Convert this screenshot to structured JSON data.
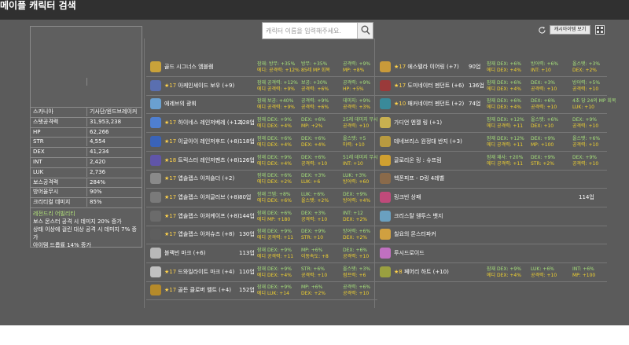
{
  "page": {
    "title": "메이플 캐릭터 검색"
  },
  "search": {
    "placeholder": "캐릭터 이름을 입력해주세요."
  },
  "toolbar": {
    "cash_item_label": "캐시아이템 보기"
  },
  "stats": [
    {
      "label": "스카니아",
      "value": "기사단/윈드브레이커"
    },
    {
      "label": "스탯공격력",
      "value": "31,953,238"
    },
    {
      "label": "HP",
      "value": "62,266"
    },
    {
      "label": "STR",
      "value": "4,554"
    },
    {
      "label": "DEX",
      "value": "41,234"
    },
    {
      "label": "INT",
      "value": "2,420"
    },
    {
      "label": "LUK",
      "value": "2,736"
    },
    {
      "label": "보스공격력",
      "value": "284%"
    },
    {
      "label": "방어율무시",
      "value": "90%"
    },
    {
      "label": "크리티컬 데미지",
      "value": "85%"
    }
  ],
  "ability": {
    "title": "레전드리 어빌리티",
    "lines": [
      "보스 몬스터 공격 시 데미지 20% 증가",
      "상태 이상에 걸린 대상 공격 시 데미지 7% 증가",
      "아이템 드롭률 14% 증가"
    ]
  },
  "items_left": [
    {
      "stars": "",
      "name": "골드 시그너스 엠블렘",
      "level": "",
      "color": "#c9a23a",
      "p": [
        [
          "잠재: 방무: +35%",
          "g"
        ],
        [
          "에디: 공격력: +12%",
          "y"
        ]
      ],
      "q": [
        [
          "방무: +35%",
          "g"
        ],
        [
          "85레 MP 회복",
          "y"
        ]
      ],
      "r": [
        [
          "공격력: +9%",
          "g"
        ],
        [
          "MP: +8%",
          "y"
        ]
      ]
    },
    {
      "stars": "★17",
      "name": "아케인셰이드 보우 (+9)",
      "level": "",
      "color": "#5a6fb0",
      "p": [
        [
          "잠재 공격력: +12%",
          "g"
        ],
        [
          "에디 공격력: +9%",
          "y"
        ]
      ],
      "q": [
        [
          "보공: +30%",
          "g"
        ],
        [
          "공격력: +6%",
          "y"
        ]
      ],
      "r": [
        [
          "공격력: +9%",
          "g"
        ],
        [
          "HP: +5%",
          "y"
        ]
      ]
    },
    {
      "stars": "",
      "name": "에레브의 광휘",
      "level": "",
      "color": "#6aa0d0",
      "p": [
        [
          "잠재 보공: +40%",
          "g"
        ],
        [
          "에디 공격력: +9%",
          "y"
        ]
      ],
      "q": [
        [
          "공격력: +9%",
          "g"
        ],
        [
          "공격력: +6%",
          "y"
        ]
      ],
      "r": [
        [
          "데미지: +9%",
          "g"
        ],
        [
          "공격력: +3%",
          "y"
        ]
      ]
    },
    {
      "stars": "★17",
      "name": "하이네스 레인저베레 (+12)",
      "level": "128업",
      "color": "#4f7fd0",
      "p": [
        [
          "잠재 DEX: +9%",
          "g"
        ],
        [
          "에디 DEX: +4%",
          "y"
        ]
      ],
      "q": [
        [
          "DEX: +6%",
          "g"
        ],
        [
          "MP: +2%",
          "y"
        ]
      ],
      "r": [
        [
          "25레 데미지 무시",
          "g"
        ],
        [
          "공격력: +10",
          "y"
        ]
      ]
    },
    {
      "stars": "★17",
      "name": "이글아이 레인저후드 (+8)",
      "level": "118업",
      "color": "#3a63b8",
      "p": [
        [
          "잠재 DEX: +6%",
          "g"
        ],
        [
          "에디 DEX: +4%",
          "y"
        ]
      ],
      "q": [
        [
          "DEX: +6%",
          "g"
        ],
        [
          "DEX: +4%",
          "y"
        ]
      ],
      "r": [
        [
          "올스탯: +5",
          "g"
        ],
        [
          "마력: +10",
          "y"
        ]
      ]
    },
    {
      "stars": "★18",
      "name": "트릭스터 레인저팬츠 (+8)",
      "level": "126업",
      "color": "#6055a8",
      "p": [
        [
          "잠재 DEX: +9%",
          "g"
        ],
        [
          "에디 DEX: +4%",
          "y"
        ]
      ],
      "q": [
        [
          "DEX: +6%",
          "g"
        ],
        [
          "공격력: +10",
          "y"
        ]
      ],
      "r": [
        [
          "51레 데미지 무시",
          "g"
        ],
        [
          "INT: +10",
          "y"
        ]
      ]
    },
    {
      "stars": "★17",
      "name": "앱솔랩스 아처숄더 (+2)",
      "level": "",
      "color": "#8a8a8a",
      "p": [
        [
          "잠재 DEX: +6%",
          "g"
        ],
        [
          "에디 DEX: +2%",
          "y"
        ]
      ],
      "q": [
        [
          "DEX: +3%",
          "g"
        ],
        [
          "LUK: +6",
          "y"
        ]
      ],
      "r": [
        [
          "LUK: +3%",
          "g"
        ],
        [
          "방어력: +60",
          "y"
        ]
      ]
    },
    {
      "stars": "★17",
      "name": "앱솔랩스 아처글러브 (+8)",
      "level": "80업",
      "color": "#7a7a7a",
      "p": [
        [
          "잠재 크뎀: +8%",
          "g"
        ],
        [
          "에디 DEX: +6%",
          "y"
        ]
      ],
      "q": [
        [
          "LUK: +6%",
          "g"
        ],
        [
          "올스탯: +2%",
          "y"
        ]
      ],
      "r": [
        [
          "DEX: +9%",
          "g"
        ],
        [
          "방어력: +4%",
          "y"
        ]
      ]
    },
    {
      "stars": "★17",
      "name": "앱솔랩스 아처케이프 (+8)",
      "level": "144업",
      "color": "#6b6b6b",
      "p": [
        [
          "잠재 DEX: +6%",
          "g"
        ],
        [
          "에디 MP: +180",
          "y"
        ]
      ],
      "q": [
        [
          "DEX: +3%",
          "g"
        ],
        [
          "공격력: +10",
          "y"
        ]
      ],
      "r": [
        [
          "INT: +12",
          "g"
        ],
        [
          "DEX: +2%",
          "y"
        ]
      ]
    },
    {
      "stars": "★17",
      "name": "앱솔랩스 아처슈즈 (+8)",
      "level": "130업",
      "color": "#5e5e5e",
      "p": [
        [
          "잠재 DEX: +9%",
          "g"
        ],
        [
          "에디 공격력: +11",
          "y"
        ]
      ],
      "q": [
        [
          "DEX: +9%",
          "g"
        ],
        [
          "STR: +10",
          "y"
        ]
      ],
      "r": [
        [
          "방어력: +6%",
          "g"
        ],
        [
          "DEX: +2%",
          "y"
        ]
      ]
    },
    {
      "stars": "",
      "name": "블랙빈 마크 (+6)",
      "level": "113업",
      "color": "#b8b8b8",
      "p": [
        [
          "잠재 DEX: +9%",
          "g"
        ],
        [
          "에디 공격력: +11",
          "y"
        ]
      ],
      "q": [
        [
          "MP: +6%",
          "g"
        ],
        [
          "이동속도: +8",
          "y"
        ]
      ],
      "r": [
        [
          "DEX: +6%",
          "g"
        ],
        [
          "공격력: +10",
          "y"
        ]
      ]
    },
    {
      "stars": "★17",
      "name": "드와일라이트 마크 (+4)",
      "level": "110업",
      "color": "#c0c0c0",
      "p": [
        [
          "잠재 DEX: +9%",
          "g"
        ],
        [
          "에디 DEX: +4%",
          "y"
        ]
      ],
      "q": [
        [
          "STR: +6%",
          "g"
        ],
        [
          "공격력: +10",
          "y"
        ]
      ],
      "r": [
        [
          "올스탯: +3%",
          "g"
        ],
        [
          "점프력: +6",
          "y"
        ]
      ]
    },
    {
      "stars": "★17",
      "name": "골든 클로버 벨트 (+4)",
      "level": "152업",
      "color": "#b58a2a",
      "p": [
        [
          "잠재 DEX: +9%",
          "g"
        ],
        [
          "에디 LUK: +14",
          "y"
        ]
      ],
      "q": [
        [
          "MP: +6%",
          "g"
        ],
        [
          "DEX: +2%",
          "y"
        ]
      ],
      "r": [
        [
          "공격력: +6%",
          "g"
        ],
        [
          "공격력: +10",
          "y"
        ]
      ]
    }
  ],
  "items_right": [
    {
      "stars": "★17",
      "name": "에스텔라 이어링 (+7)",
      "level": "90업",
      "color": "#c89a3a",
      "p": [
        [
          "잠재 DEX: +6%",
          "g"
        ],
        [
          "에디 DEX: +4%",
          "y"
        ]
      ],
      "q": [
        [
          "방어력: +6%",
          "g"
        ],
        [
          "INT: +10",
          "y"
        ]
      ],
      "r": [
        [
          "올스탯: +3%",
          "g"
        ],
        [
          "DEX: +2%",
          "y"
        ]
      ]
    },
    {
      "stars": "★17",
      "name": "도미네이터 펜던트 (+6)",
      "level": "136업",
      "color": "#9a3a3a",
      "p": [
        [
          "잠재 DEX: +6%",
          "g"
        ],
        [
          "에디 DEX: +4%",
          "y"
        ]
      ],
      "q": [
        [
          "DEX: +3%",
          "g"
        ],
        [
          "공격력: +10",
          "y"
        ]
      ],
      "r": [
        [
          "방어력: +5%",
          "g"
        ],
        [
          "공격력: +10",
          "y"
        ]
      ]
    },
    {
      "stars": "★10",
      "name": "매커네이터 펜던트 (+2)",
      "level": "74업",
      "color": "#3a8a9a",
      "p": [
        [
          "잠재 DEX: +6%",
          "g"
        ],
        [
          "에디 DEX: +4%",
          "y"
        ]
      ],
      "q": [
        [
          "DEX: +6%",
          "g"
        ],
        [
          "공격력: +10",
          "y"
        ]
      ],
      "r": [
        [
          "4초 당 24의 MP 회복",
          "g"
        ],
        [
          "LUK: +10",
          "y"
        ]
      ]
    },
    {
      "stars": "",
      "name": "가디언 엔젤 링 (+1)",
      "level": "",
      "color": "#c8b050",
      "p": [
        [
          "잠재 DEX: +12%",
          "g"
        ],
        [
          "에디 공격력: +11",
          "y"
        ]
      ],
      "q": [
        [
          "올스탯: +6%",
          "g"
        ],
        [
          "DEX: +10",
          "y"
        ]
      ],
      "r": [
        [
          "DEX: +9%",
          "g"
        ],
        [
          "공격력: +10",
          "y"
        ]
      ]
    },
    {
      "stars": "",
      "name": "테네브리스 원정대 반지 (+3)",
      "level": "",
      "color": "#b89a40",
      "p": [
        [
          "잠재 DEX: +12%",
          "g"
        ],
        [
          "에디 공격력: +11",
          "y"
        ]
      ],
      "q": [
        [
          "DEX: +9%",
          "g"
        ],
        [
          "MP: +100",
          "y"
        ]
      ],
      "r": [
        [
          "올스탯: +6%",
          "g"
        ],
        [
          "공격력: +10",
          "y"
        ]
      ]
    },
    {
      "stars": "",
      "name": "글로리온 링 : 슈프림",
      "level": "",
      "color": "#d0a030",
      "p": [
        [
          "잠재 재사: +20%",
          "g"
        ],
        [
          "에디 공격력: +11",
          "y"
        ]
      ],
      "q": [
        [
          "DEX: +9%",
          "g"
        ],
        [
          "STR: +2%",
          "y"
        ]
      ],
      "r": [
        [
          "DEX: +9%",
          "g"
        ],
        [
          "공격력: +10",
          "y"
        ]
      ]
    },
    {
      "stars": "",
      "name": "헥폰피프 - D링 4레벨",
      "level": "",
      "color": "#8a6a4a",
      "p": [],
      "q": [],
      "r": []
    },
    {
      "stars": "",
      "name": "링크빈 상패",
      "level": "114업",
      "color": "#c04a7a",
      "p": [],
      "q": [],
      "r": []
    },
    {
      "stars": "",
      "name": "크리스탈 웬투스 뱃지",
      "level": "",
      "color": "#6aa0c0",
      "p": [],
      "q": [],
      "r": []
    },
    {
      "stars": "",
      "name": "칠요의 몬스터파커",
      "level": "",
      "color": "#d0a040",
      "p": [],
      "q": [],
      "r": []
    },
    {
      "stars": "",
      "name": "루시드로이드",
      "level": "",
      "color": "#c070c0",
      "p": [],
      "q": [],
      "r": []
    },
    {
      "stars": "★8",
      "name": "페어리 하트 (+10)",
      "level": "",
      "color": "#9aa040",
      "p": [
        [
          "잠재 DEX: +9%",
          "g"
        ],
        [
          "에디 DEX: +4%",
          "y"
        ]
      ],
      "q": [
        [
          "LUK: +6%",
          "g"
        ],
        [
          "공격력: +10",
          "y"
        ]
      ],
      "r": [
        [
          "INT: +6%",
          "g"
        ],
        [
          "MP: +100",
          "y"
        ]
      ]
    }
  ]
}
